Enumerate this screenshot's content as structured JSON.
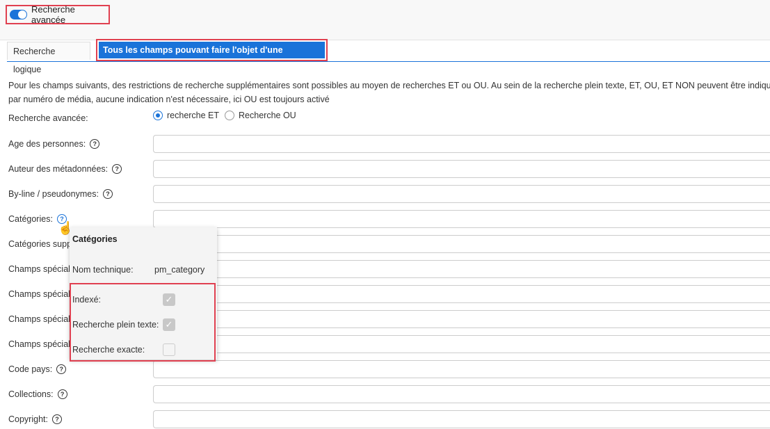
{
  "toggle": {
    "label": "Recherche avancée"
  },
  "tabs": {
    "logic": "Recherche logique",
    "all_fields": "Tous les champs pouvant faire l'objet d'une recherche"
  },
  "description": {
    "line1": "Pour les champs suivants, des restrictions de recherche supplémentaires sont possibles au moyen de recherches ET ou OU. Au sein de la recherche plein texte, ET, OU, ET NON peuvent être indiqués",
    "line2": "par numéro de média, aucune indication n'est nécessaire, ici OU est toujours activé"
  },
  "advanced": {
    "label": "Recherche avancée:",
    "option_and": "recherche ET",
    "option_or": "Recherche OU"
  },
  "fields": [
    "Age des personnes:",
    "Auteur des métadonnées:",
    "By-line / pseudonymes:",
    "Catégories:",
    "Catégories supp",
    "Champs spécial",
    "Champs spécial",
    "Champs spécial",
    "Champs spécial",
    "Code pays:",
    "Collections:",
    "Copyright:"
  ],
  "help_symbol": "?",
  "popup": {
    "title": "Catégories",
    "tech_label": "Nom technique:",
    "tech_value": "pm_category",
    "indexed": "Indexé:",
    "fulltext": "Recherche plein texte:",
    "exact": "Recherche exacte:",
    "checkmark": "✓"
  },
  "cursor_glyph": "☝"
}
